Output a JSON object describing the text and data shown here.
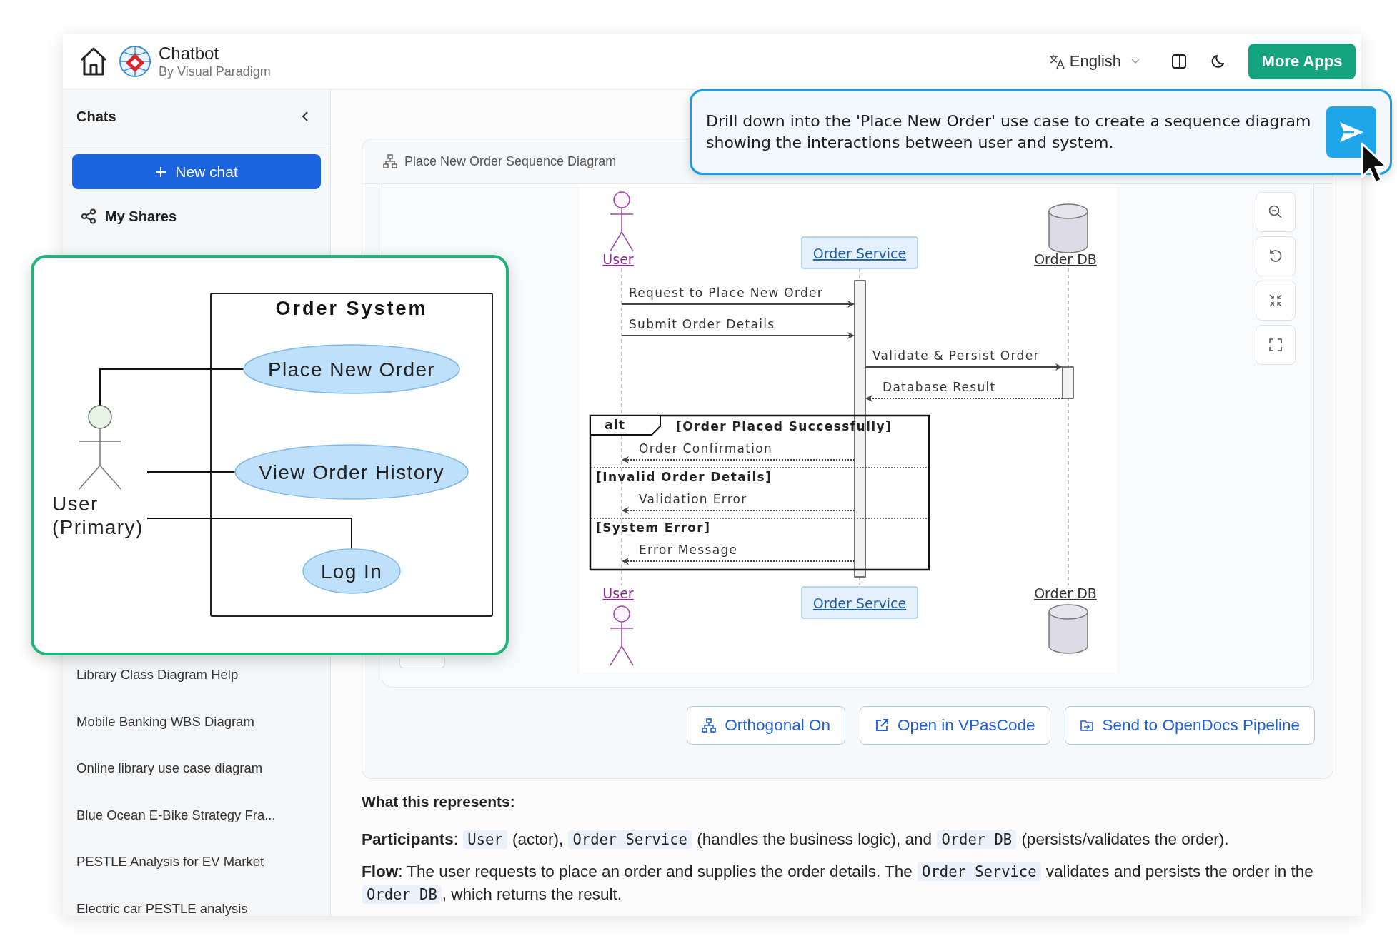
{
  "header": {
    "title": "Chatbot",
    "subtitle": "By Visual Paradigm",
    "language": "English",
    "more_apps": "More Apps"
  },
  "sidebar": {
    "heading": "Chats",
    "new_chat": "New chat",
    "my_shares": "My Shares",
    "chats": [
      {
        "title": "Library Class Diagram Help"
      },
      {
        "title": "Mobile Banking WBS Diagram"
      },
      {
        "title": "Online library use case diagram"
      },
      {
        "title": "Blue Ocean E-Bike Strategy Fra..."
      },
      {
        "title": "PESTLE Analysis for EV Market"
      },
      {
        "title": "Electric car PESTLE analysis"
      }
    ]
  },
  "diagram_panel": {
    "title": "Place New Order Sequence Diagram",
    "sequence": {
      "participants_top": [
        {
          "name": "User",
          "kind": "actor"
        },
        {
          "name": "Order Service",
          "kind": "service"
        },
        {
          "name": "Order DB",
          "kind": "database"
        }
      ],
      "steps": [
        {
          "kind": "call",
          "label": "Request to Place New Order"
        },
        {
          "kind": "call",
          "label": "Submit Order Details"
        },
        {
          "kind": "call",
          "label": "Validate & Persist Order"
        },
        {
          "kind": "return",
          "label": "Database Result"
        },
        {
          "kind": "fragment",
          "operator": "alt",
          "operands": [
            {
              "guard": "[Order Placed Successfully]",
              "messages": [
                {
                  "kind": "return",
                  "label": "Order Confirmation"
                }
              ]
            },
            {
              "guard": "[Invalid Order Details]",
              "messages": [
                {
                  "kind": "return",
                  "label": "Validation Error"
                }
              ]
            },
            {
              "guard": "[System Error]",
              "messages": [
                {
                  "kind": "return",
                  "label": "Error Message"
                }
              ]
            }
          ]
        }
      ],
      "participants_bottom": [
        {
          "name": "User",
          "kind": "actor"
        },
        {
          "name": "Order Service",
          "kind": "service"
        },
        {
          "name": "Order DB",
          "kind": "database"
        }
      ]
    },
    "actions": [
      {
        "label": "Orthogonal On"
      },
      {
        "label": "Open in VPasCode"
      },
      {
        "label": "Send to OpenDocs Pipeline"
      }
    ]
  },
  "explanation": {
    "heading": "What this represents:",
    "paragraphs": [
      [
        {
          "kind": "bold",
          "text": "Participants"
        },
        {
          "kind": "plain",
          "text": ": "
        },
        {
          "kind": "code",
          "text": "User"
        },
        {
          "kind": "plain",
          "text": " (actor), "
        },
        {
          "kind": "code",
          "text": "Order Service"
        },
        {
          "kind": "plain",
          "text": " (handles the business logic), and "
        },
        {
          "kind": "code",
          "text": "Order DB"
        },
        {
          "kind": "plain",
          "text": " (persists/validates the order)."
        }
      ],
      [
        {
          "kind": "bold",
          "text": "Flow"
        },
        {
          "kind": "plain",
          "text": ": The user requests to place an order and supplies the order details. The "
        },
        {
          "kind": "code",
          "text": "Order Service"
        },
        {
          "kind": "plain",
          "text": " validates and persists the order in the "
        },
        {
          "kind": "code",
          "text": "Order DB"
        },
        {
          "kind": "plain",
          "text": ", which returns the result."
        }
      ]
    ]
  },
  "prompt": {
    "text": "Drill down into the 'Place New Order' use case to create a sequence diagram showing the interactions between user and system."
  },
  "use_case_overlay": {
    "system": "Order System",
    "actor_label_lines": [
      "User",
      "(Primary)"
    ],
    "use_cases": [
      {
        "name": "Place New Order"
      },
      {
        "name": "View Order History"
      },
      {
        "name": "Log In"
      }
    ]
  }
}
